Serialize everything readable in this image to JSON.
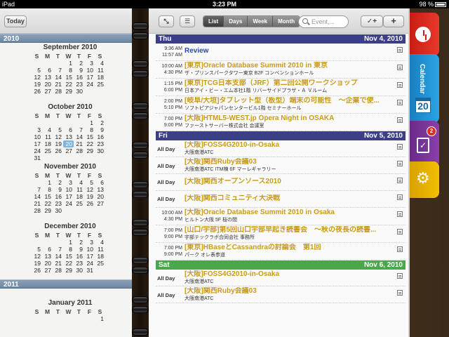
{
  "status_bar": {
    "device": "iPad",
    "time": "3:23 PM",
    "battery": "98 %"
  },
  "left_page": {
    "today_label": "Today",
    "year_2010": "2010",
    "weekday_headers": [
      "S",
      "M",
      "T",
      "W",
      "T",
      "F",
      "S"
    ],
    "months": [
      {
        "title": "September 2010",
        "days": [
          "",
          "",
          "",
          "1",
          "2",
          "3",
          "4",
          "5",
          "6",
          "7",
          "8",
          "9",
          "10",
          "11",
          "12",
          "13",
          "14",
          "15",
          "16",
          "17",
          "18",
          "19",
          "20",
          "21",
          "22",
          "23",
          "24",
          "25",
          "26",
          "27",
          "28",
          "29",
          "30"
        ]
      },
      {
        "title": "October 2010",
        "days": [
          "",
          "",
          "",
          "",
          "",
          "1",
          "2",
          "3",
          "4",
          "5",
          "6",
          "7",
          "8",
          "9",
          "10",
          "11",
          "12",
          "13",
          "14",
          "15",
          "16",
          "17",
          "18",
          "19",
          "20",
          "21",
          "22",
          "23",
          "24",
          "25",
          "26",
          "27",
          "28",
          "29",
          "30",
          "31"
        ]
      },
      {
        "title": "November 2010",
        "days": [
          "",
          "1",
          "2",
          "3",
          "4",
          "5",
          "6",
          "7",
          "8",
          "9",
          "10",
          "11",
          "12",
          "13",
          "14",
          "15",
          "16",
          "17",
          "18",
          "19",
          "20",
          "21",
          "22",
          "23",
          "24",
          "25",
          "26",
          "27",
          "28",
          "29",
          "30"
        ]
      },
      {
        "title": "December 2010",
        "days": [
          "",
          "",
          "",
          "1",
          "2",
          "3",
          "4",
          "5",
          "6",
          "7",
          "8",
          "9",
          "10",
          "11",
          "12",
          "13",
          "14",
          "15",
          "16",
          "17",
          "18",
          "19",
          "20",
          "21",
          "22",
          "23",
          "24",
          "25",
          "26",
          "27",
          "28",
          "29",
          "30",
          "31"
        ]
      }
    ],
    "year_2011": "2011",
    "january_2011": {
      "title": "January 2011",
      "days": [
        "",
        "",
        "",
        "",
        "",
        "",
        "1"
      ]
    },
    "highlighted_day": "20"
  },
  "toolbar": {
    "view_tabs": [
      "List",
      "Days",
      "Week",
      "Month"
    ],
    "selected_view": "List",
    "search_placeholder": "Event,...",
    "add_label": "+",
    "check_label": "✓+"
  },
  "days": [
    {
      "weekday": "Thu",
      "date": "Nov 4, 2010",
      "color": "#3b3f86",
      "events": [
        {
          "start": "9:36 AM",
          "end": "11:57 AM",
          "title": "Review",
          "location": "",
          "title_color": "#2a4aa8"
        },
        {
          "start": "10:00 AM",
          "end": "4:30 PM",
          "title": "[東京]Oracle Database Summit 2010 in 東京",
          "location": "ザ・プリンスパークタワー東京 B2F コンベンションホール"
        },
        {
          "start": "1:15 PM",
          "end": "6:00 PM",
          "title": "[東京]TCG日本支部（JRF）第二回公開ワークショップ",
          "location": "日本アイ・ビー・エム本社1階 リバーサイドプラザ・Ａ Ｖルーム"
        },
        {
          "start": "2:00 PM",
          "end": "5:10 PM",
          "title": "[岐阜/大垣]タブレット型（板型）端末の可能性　～企業で使...",
          "location": "ソフトピアジャパンセンタービル1階 セミナーホール"
        },
        {
          "start": "7:00 PM",
          "end": "9:00 PM",
          "title": "[大阪]HTML5-WEST.jp Opera Night in OSAKA",
          "location": "ファーストサーバー株式会社 会議室"
        }
      ]
    },
    {
      "weekday": "Fri",
      "date": "Nov 5, 2010",
      "color": "#3b3f86",
      "events": [
        {
          "start": "All Day",
          "end": "",
          "title": "[大阪]FOSS4G2010-in-Osaka",
          "location": "大阪南港ATC"
        },
        {
          "start": "All Day",
          "end": "",
          "title": "[大阪]関西Ruby会議03",
          "location": "大阪南港ATC ITM棟 6F マーレギャラリー"
        },
        {
          "start": "All Day",
          "end": "",
          "title": "[大阪]関西オープンソース2010",
          "location": ""
        },
        {
          "start": "All Day",
          "end": "",
          "title": "[大阪]関西コミュニティ大決戦",
          "location": ""
        },
        {
          "start": "10:00 AM",
          "end": "4:30 PM",
          "title": "[大阪]Oracle Database Summit 2010 in Osaka",
          "location": "ヒルトン大阪 5F 桜の間"
        },
        {
          "start": "7:00 PM",
          "end": "9:00 PM",
          "title": "[山口/宇部]第5回山口宇部早起き読書会　～秋の夜長の読書...",
          "location": "宇部テックラボ合同会社 事務所"
        },
        {
          "start": "7:00 PM",
          "end": "9:00 PM",
          "title": "[東京]HBaseとCassandraの討論会　第1回",
          "location": "パーク オレ表参道"
        }
      ]
    },
    {
      "weekday": "Sat",
      "date": "Nov 6, 2010",
      "color": "#4aa84a",
      "events": [
        {
          "start": "All Day",
          "end": "",
          "title": "[大阪]FOSS4G2010-in-Osaka",
          "location": "大阪南港ATC"
        },
        {
          "start": "All Day",
          "end": "",
          "title": "[大阪]関西Ruby会議03",
          "location": "大阪南港ATC"
        }
      ]
    }
  ],
  "side_tabs": {
    "calendar_label": "Calendar",
    "calendar_date": "20",
    "tasks_badge": "2"
  }
}
